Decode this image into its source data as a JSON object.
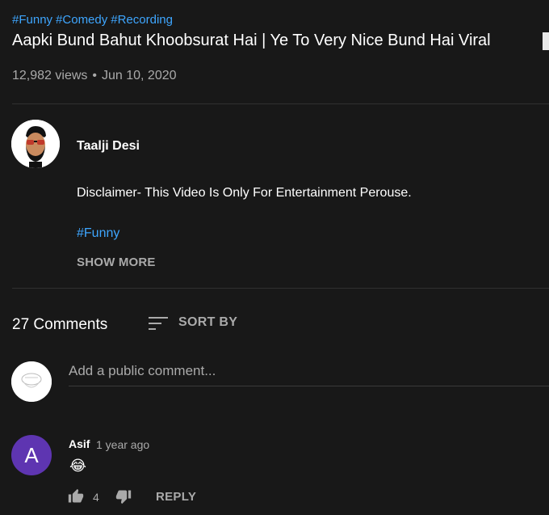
{
  "video": {
    "hashtags": [
      "#Funny",
      "#Comedy",
      "#Recording"
    ],
    "title": "Aapki Bund Bahut Khoobsurat Hai | Ye To Very Nice Bund Hai Viral",
    "views": "12,982 views",
    "separator": "•",
    "date": "Jun 10, 2020"
  },
  "channel": {
    "name": "Taalji Desi",
    "avatar_icon": "cartoon-man-sunglasses-avatar-icon"
  },
  "description": {
    "text": "Disclaimer- This Video Is Only For Entertainment Perouse.",
    "hashtag": "#Funny",
    "show_more_label": "SHOW MORE"
  },
  "comments": {
    "count_label": "27 Comments",
    "sort_label": "SORT BY",
    "input_placeholder": "Add a public comment...",
    "items": [
      {
        "avatar_letter": "A",
        "avatar_color": "#5e35b1",
        "author": "Asif",
        "time": "1 year ago",
        "text": "😂",
        "likes": "4",
        "reply_label": "REPLY"
      }
    ]
  },
  "colors": {
    "background": "#181818",
    "link": "#3ea6ff",
    "secondary_text": "#aaaaaa",
    "divider": "#303030"
  }
}
